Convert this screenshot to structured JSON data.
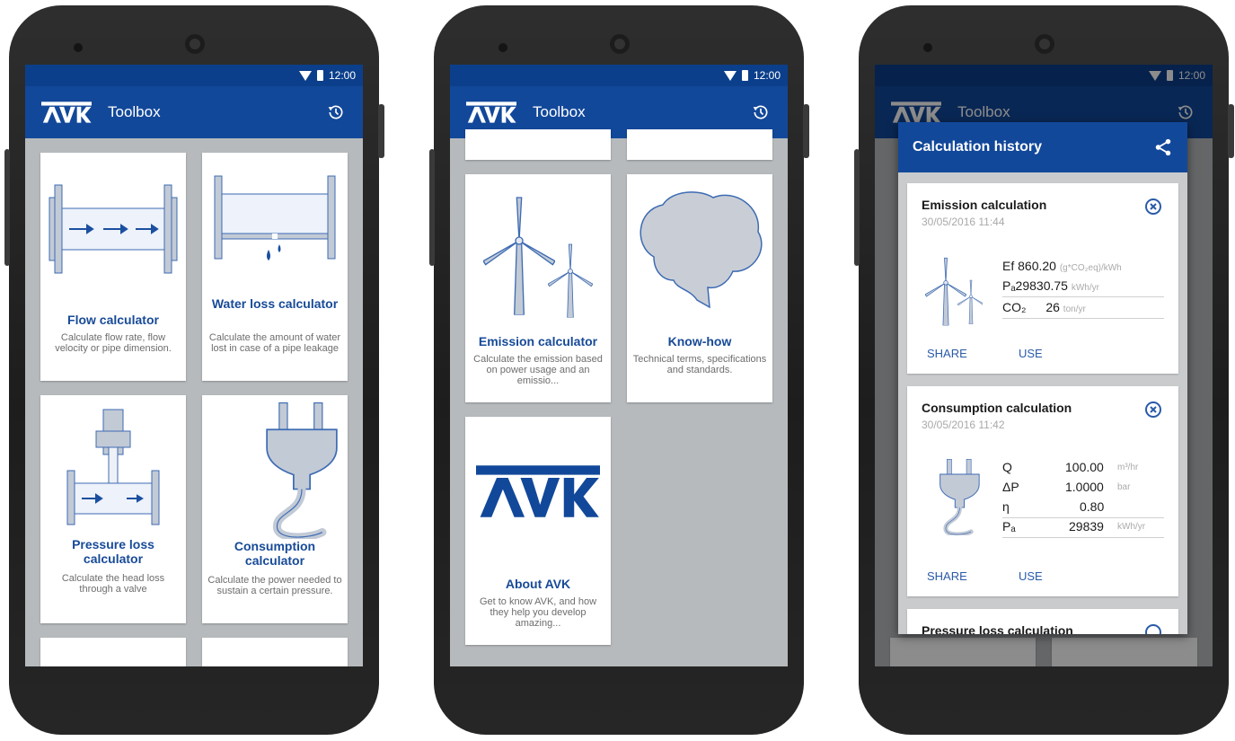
{
  "status": {
    "time": "12:00"
  },
  "app": {
    "title": "Toolbox"
  },
  "tools": [
    {
      "title": "Flow calculator",
      "desc": "Calculate flow rate, flow velocity or pipe dimension."
    },
    {
      "title": "Water loss calculator",
      "desc": "Calculate the amount of water lost in case of a pipe leakage"
    },
    {
      "title": "Pressure loss calculator",
      "desc": "Calculate the head loss through a valve"
    },
    {
      "title": "Consumption calculator",
      "desc": "Calculate the power needed to sustain a certain pressure."
    },
    {
      "title": "Emission calculator",
      "desc": "Calculate the emission based on power usage and an emissio..."
    },
    {
      "title": "Know-how",
      "desc": "Technical terms, specifications and standards."
    },
    {
      "title": "About AVK",
      "desc": "Get to know AVK, and how they help you develop amazing..."
    }
  ],
  "history": {
    "title": "Calculation history",
    "share_label": "SHARE",
    "use_label": "USE",
    "items": [
      {
        "title": "Emission calculation",
        "date": "30/05/2016 11:44",
        "rows": [
          {
            "label": "Ef",
            "value": "860.20",
            "unit": "(g*CO₂eq)/kWh"
          },
          {
            "label": "Pₐ",
            "value": "29830.75",
            "unit": "kWh/yr"
          },
          {
            "label": "CO₂",
            "value": "26",
            "unit": "ton/yr"
          }
        ]
      },
      {
        "title": "Consumption calculation",
        "date": "30/05/2016 11:42",
        "rows": [
          {
            "label": "Q",
            "value": "100.00",
            "unit": "m³/hr"
          },
          {
            "label": "ΔP",
            "value": "1.0000",
            "unit": "bar"
          },
          {
            "label": "η",
            "value": "0.80",
            "unit": ""
          },
          {
            "label": "Pₐ",
            "value": "29839",
            "unit": "kWh/yr"
          }
        ]
      },
      {
        "title": "Pressure loss calculation"
      }
    ]
  },
  "colors": {
    "primary": "#12489a",
    "status": "#0b3f8b",
    "accent_text": "#174a98"
  }
}
